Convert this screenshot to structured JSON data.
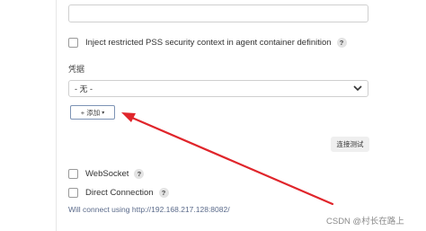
{
  "top_field": {
    "value": ""
  },
  "inject_pss": {
    "label": "Inject restricted PSS security context in agent container definition",
    "checked": false,
    "help": "?"
  },
  "credentials": {
    "label": "凭据",
    "selected": "- 无 -",
    "add_button": "+ 添加",
    "add_caret": "▾"
  },
  "test_connection": {
    "label": "连接测试"
  },
  "websocket": {
    "label": "WebSocket",
    "checked": false,
    "help": "?"
  },
  "direct_connection": {
    "label": "Direct Connection",
    "checked": false,
    "help": "?"
  },
  "connect_note": "Will connect using http://192.168.217.128:8082/",
  "watermark": "CSDN @村长在路上",
  "colors": {
    "annotation_arrow": "#e0252b",
    "link_text": "#5a6a8a"
  },
  "icons": {
    "select_chevron": "chevron-down-icon",
    "help": "help-icon"
  }
}
